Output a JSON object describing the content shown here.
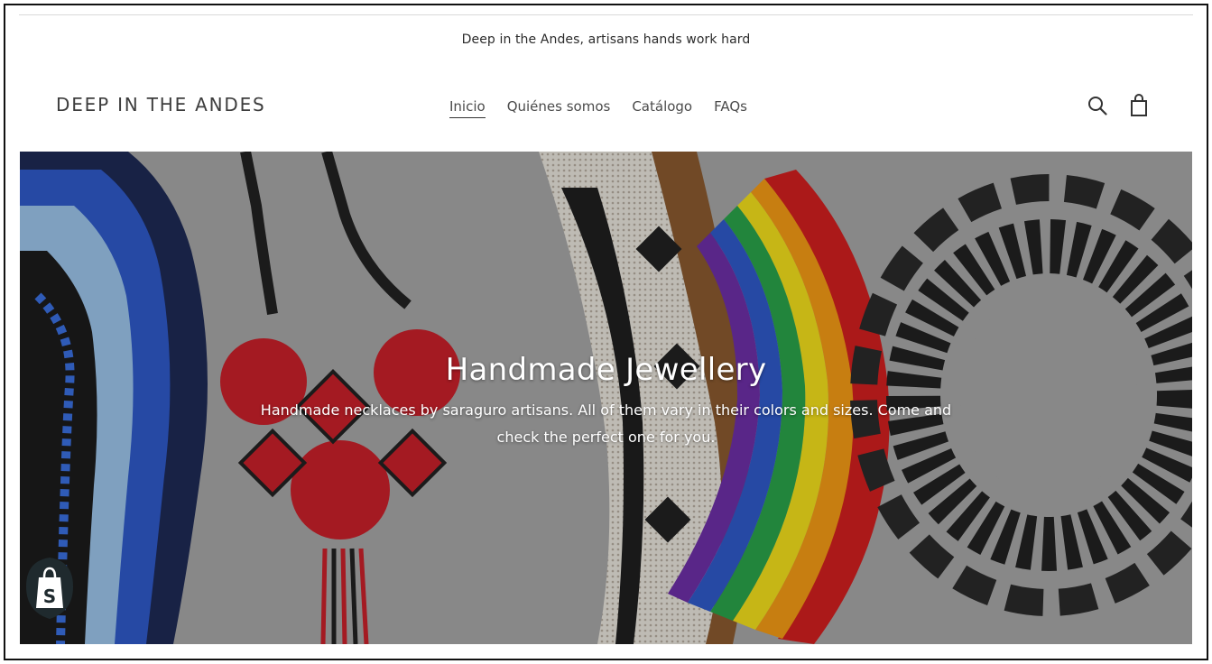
{
  "announcement": "Deep in the Andes, artisans hands work hard",
  "header": {
    "logo": "DEEP IN THE ANDES",
    "nav": [
      "Inicio",
      "Quiénes somos",
      "Catálogo",
      "FAQs"
    ],
    "icons": [
      "search-icon",
      "cart-icon"
    ]
  },
  "hero": {
    "title": "Handmade Jewellery",
    "subtitle": "Handmade necklaces by saraguro artisans. All of them vary in their colors and sizes. Come and check the perfect one for you."
  },
  "badge": {
    "icon": "shopify-icon",
    "letter": "S"
  },
  "colors": {
    "necklace_blue": "#2f59c9",
    "necklace_red": "#c8202a",
    "necklace_black": "#1e1e1e",
    "background": "#a3a3a3"
  }
}
